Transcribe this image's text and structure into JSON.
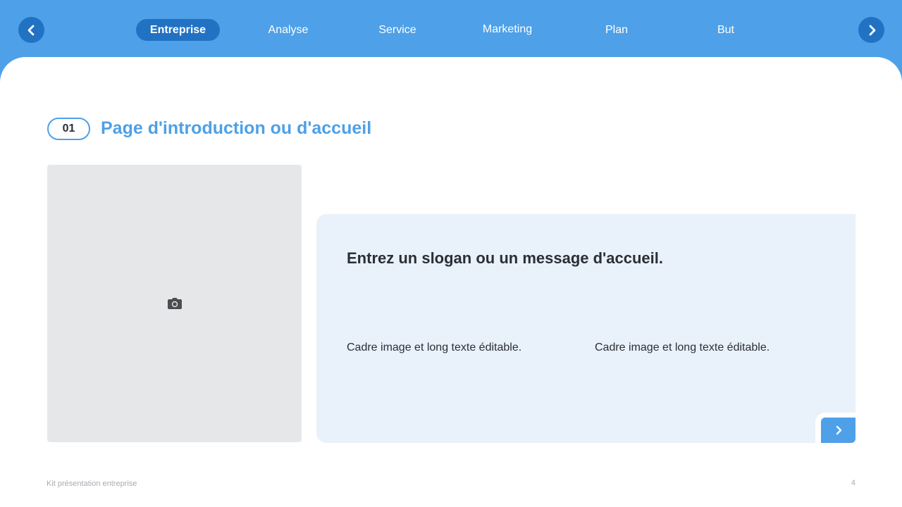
{
  "nav": {
    "tabs": [
      {
        "label": "Entreprise",
        "active": true
      },
      {
        "label": "Analyse",
        "active": false
      },
      {
        "label": "Service",
        "active": false
      },
      {
        "label": "Marketing",
        "active": false
      },
      {
        "label": "Plan",
        "active": false
      },
      {
        "label": "But",
        "active": false
      }
    ],
    "prev_icon": "chevron-left-icon",
    "next_icon": "chevron-right-icon"
  },
  "section": {
    "number": "01",
    "title": "Page d'introduction ou d'accueil"
  },
  "image_placeholder": {
    "icon": "camera-icon"
  },
  "card": {
    "slogan": "Entrez un slogan ou un message d'accueil.",
    "columns": [
      "Cadre image et long texte éditable.",
      "Cadre image et long texte éditable."
    ],
    "next_icon": "chevron-right-icon"
  },
  "footer": {
    "title": "Kit présentation entreprise",
    "page_number": "4"
  },
  "colors": {
    "accent": "#4ea0e8",
    "accent_dark": "#2272c4",
    "card_background": "#e9f1fa",
    "placeholder_background": "#e6e7e9",
    "text": "#2b2f36",
    "muted_text": "#a7abb1"
  }
}
